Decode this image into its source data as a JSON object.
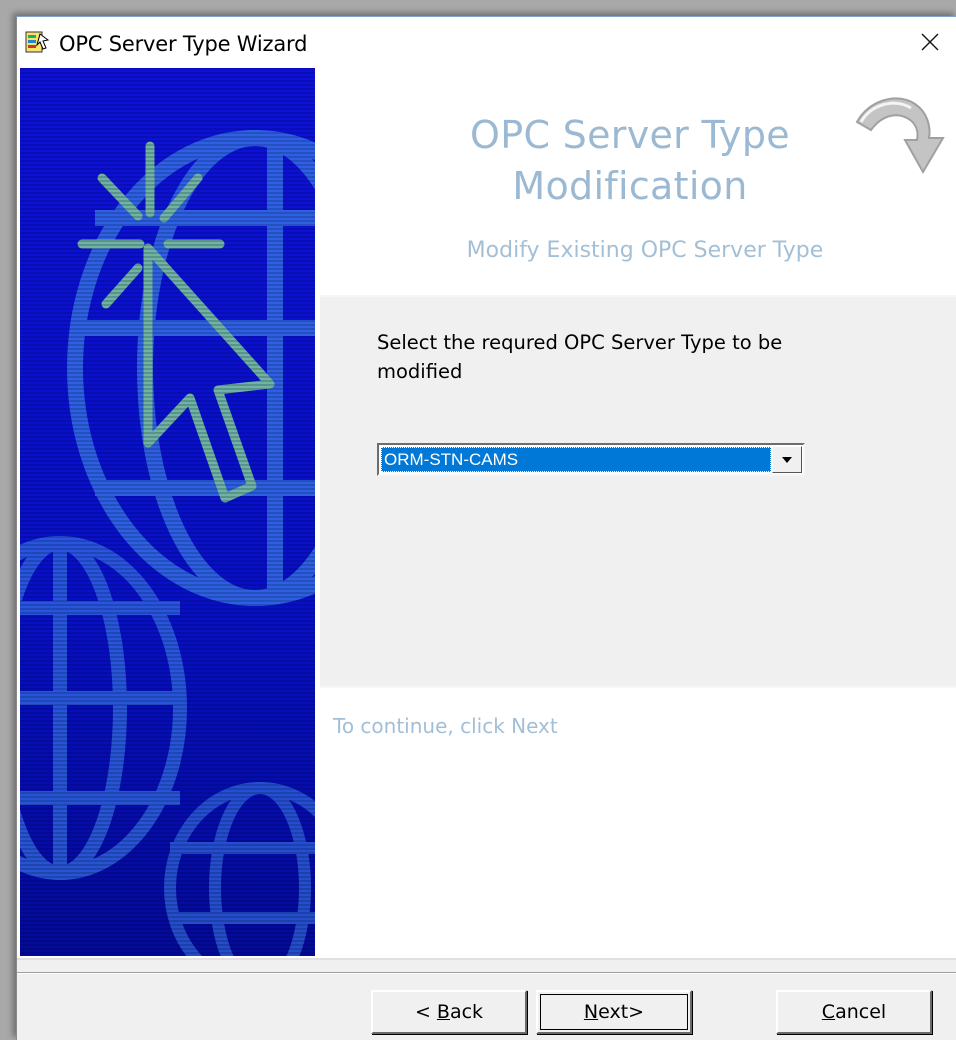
{
  "window": {
    "title": "OPC Server Type Wizard",
    "close_glyph": "✕",
    "icon": "wizard-app-icon"
  },
  "header": {
    "title_line1": "OPC Server Type",
    "title_line2": "Modification",
    "subtitle": "Modify Existing OPC Server Type",
    "arrow_icon": "curved-arrow-icon"
  },
  "content": {
    "prompt": "Select the requred OPC Server Type to be modified",
    "combo": {
      "selected_value": "ORM-STN-CAMS",
      "dropdown_icon": "triangle-down-icon"
    }
  },
  "footer": {
    "hint": "To continue, click Next"
  },
  "buttons": {
    "back_prefix": "< ",
    "back_mnemonic": "B",
    "back_rest": "ack",
    "next_mnemonic": "N",
    "next_rest": "ext>",
    "cancel_mnemonic": "C",
    "cancel_rest": "ancel"
  },
  "colors": {
    "side_panel_blue": "#0a14d0",
    "header_text": "#9bb9d2",
    "selection": "#0078d7"
  }
}
